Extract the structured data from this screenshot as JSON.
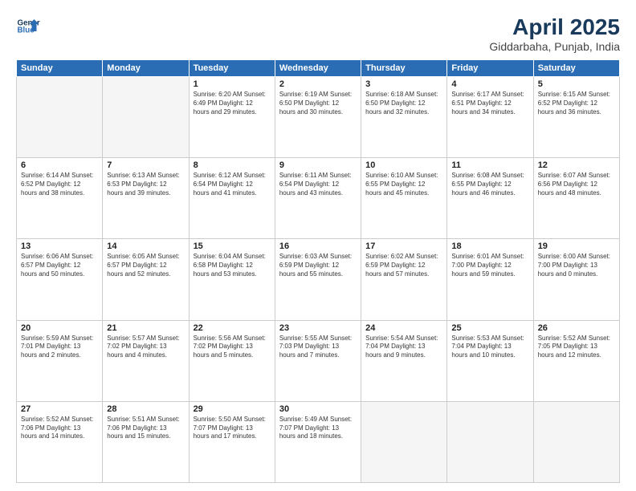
{
  "header": {
    "logo_line1": "General",
    "logo_line2": "Blue",
    "title": "April 2025",
    "subtitle": "Giddarbaha, Punjab, India"
  },
  "weekdays": [
    "Sunday",
    "Monday",
    "Tuesday",
    "Wednesday",
    "Thursday",
    "Friday",
    "Saturday"
  ],
  "weeks": [
    [
      {
        "num": "",
        "info": ""
      },
      {
        "num": "",
        "info": ""
      },
      {
        "num": "1",
        "info": "Sunrise: 6:20 AM\nSunset: 6:49 PM\nDaylight: 12 hours\nand 29 minutes."
      },
      {
        "num": "2",
        "info": "Sunrise: 6:19 AM\nSunset: 6:50 PM\nDaylight: 12 hours\nand 30 minutes."
      },
      {
        "num": "3",
        "info": "Sunrise: 6:18 AM\nSunset: 6:50 PM\nDaylight: 12 hours\nand 32 minutes."
      },
      {
        "num": "4",
        "info": "Sunrise: 6:17 AM\nSunset: 6:51 PM\nDaylight: 12 hours\nand 34 minutes."
      },
      {
        "num": "5",
        "info": "Sunrise: 6:15 AM\nSunset: 6:52 PM\nDaylight: 12 hours\nand 36 minutes."
      }
    ],
    [
      {
        "num": "6",
        "info": "Sunrise: 6:14 AM\nSunset: 6:52 PM\nDaylight: 12 hours\nand 38 minutes."
      },
      {
        "num": "7",
        "info": "Sunrise: 6:13 AM\nSunset: 6:53 PM\nDaylight: 12 hours\nand 39 minutes."
      },
      {
        "num": "8",
        "info": "Sunrise: 6:12 AM\nSunset: 6:54 PM\nDaylight: 12 hours\nand 41 minutes."
      },
      {
        "num": "9",
        "info": "Sunrise: 6:11 AM\nSunset: 6:54 PM\nDaylight: 12 hours\nand 43 minutes."
      },
      {
        "num": "10",
        "info": "Sunrise: 6:10 AM\nSunset: 6:55 PM\nDaylight: 12 hours\nand 45 minutes."
      },
      {
        "num": "11",
        "info": "Sunrise: 6:08 AM\nSunset: 6:55 PM\nDaylight: 12 hours\nand 46 minutes."
      },
      {
        "num": "12",
        "info": "Sunrise: 6:07 AM\nSunset: 6:56 PM\nDaylight: 12 hours\nand 48 minutes."
      }
    ],
    [
      {
        "num": "13",
        "info": "Sunrise: 6:06 AM\nSunset: 6:57 PM\nDaylight: 12 hours\nand 50 minutes."
      },
      {
        "num": "14",
        "info": "Sunrise: 6:05 AM\nSunset: 6:57 PM\nDaylight: 12 hours\nand 52 minutes."
      },
      {
        "num": "15",
        "info": "Sunrise: 6:04 AM\nSunset: 6:58 PM\nDaylight: 12 hours\nand 53 minutes."
      },
      {
        "num": "16",
        "info": "Sunrise: 6:03 AM\nSunset: 6:59 PM\nDaylight: 12 hours\nand 55 minutes."
      },
      {
        "num": "17",
        "info": "Sunrise: 6:02 AM\nSunset: 6:59 PM\nDaylight: 12 hours\nand 57 minutes."
      },
      {
        "num": "18",
        "info": "Sunrise: 6:01 AM\nSunset: 7:00 PM\nDaylight: 12 hours\nand 59 minutes."
      },
      {
        "num": "19",
        "info": "Sunrise: 6:00 AM\nSunset: 7:00 PM\nDaylight: 13 hours\nand 0 minutes."
      }
    ],
    [
      {
        "num": "20",
        "info": "Sunrise: 5:59 AM\nSunset: 7:01 PM\nDaylight: 13 hours\nand 2 minutes."
      },
      {
        "num": "21",
        "info": "Sunrise: 5:57 AM\nSunset: 7:02 PM\nDaylight: 13 hours\nand 4 minutes."
      },
      {
        "num": "22",
        "info": "Sunrise: 5:56 AM\nSunset: 7:02 PM\nDaylight: 13 hours\nand 5 minutes."
      },
      {
        "num": "23",
        "info": "Sunrise: 5:55 AM\nSunset: 7:03 PM\nDaylight: 13 hours\nand 7 minutes."
      },
      {
        "num": "24",
        "info": "Sunrise: 5:54 AM\nSunset: 7:04 PM\nDaylight: 13 hours\nand 9 minutes."
      },
      {
        "num": "25",
        "info": "Sunrise: 5:53 AM\nSunset: 7:04 PM\nDaylight: 13 hours\nand 10 minutes."
      },
      {
        "num": "26",
        "info": "Sunrise: 5:52 AM\nSunset: 7:05 PM\nDaylight: 13 hours\nand 12 minutes."
      }
    ],
    [
      {
        "num": "27",
        "info": "Sunrise: 5:52 AM\nSunset: 7:06 PM\nDaylight: 13 hours\nand 14 minutes."
      },
      {
        "num": "28",
        "info": "Sunrise: 5:51 AM\nSunset: 7:06 PM\nDaylight: 13 hours\nand 15 minutes."
      },
      {
        "num": "29",
        "info": "Sunrise: 5:50 AM\nSunset: 7:07 PM\nDaylight: 13 hours\nand 17 minutes."
      },
      {
        "num": "30",
        "info": "Sunrise: 5:49 AM\nSunset: 7:07 PM\nDaylight: 13 hours\nand 18 minutes."
      },
      {
        "num": "",
        "info": ""
      },
      {
        "num": "",
        "info": ""
      },
      {
        "num": "",
        "info": ""
      }
    ]
  ]
}
